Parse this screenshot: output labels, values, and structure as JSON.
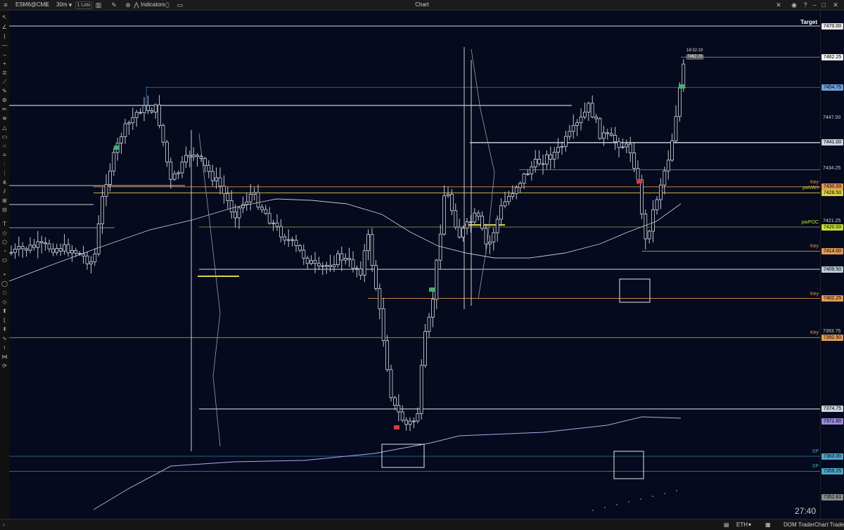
{
  "titlebar": {
    "symbol": "ESM6@CME",
    "timeframe": "30m",
    "lots": "1 Lots",
    "indicators": "Indicators",
    "window_title": "Chart"
  },
  "levels": [
    {
      "label": "",
      "price": "7470.00",
      "tag_color": "#e8e8e8"
    },
    {
      "label": "",
      "price": "7462.25",
      "tag_color": "#f2f2f2"
    },
    {
      "label": "",
      "price": "7454.75",
      "tag_color": "#6fa0d8"
    },
    {
      "label": "",
      "price": "7447.00",
      "tag_color": ""
    },
    {
      "label": "",
      "price": "7441.00",
      "tag_color": "#c9d4dc"
    },
    {
      "label": "",
      "price": "7434.25",
      "tag_color": ""
    },
    {
      "label": "Key",
      "price": "7430.00",
      "tag_color": "#e39a55"
    },
    {
      "label": "pwVAH",
      "price": "7428.50",
      "tag_color": "#d9cf3f"
    },
    {
      "label": "",
      "price": "7421.25",
      "tag_color": ""
    },
    {
      "label": "pwPOC",
      "price": "7420.00",
      "tag_color": "#c7dd3a"
    },
    {
      "label": "Key",
      "price": "7414.00",
      "tag_color": "#e39a55"
    },
    {
      "label": "",
      "price": "7409.50",
      "tag_color": "#b8c8d4"
    },
    {
      "label": "Key",
      "price": "7402.25",
      "tag_color": "#e39a55"
    },
    {
      "label": "",
      "price": "7393.75",
      "tag_color": ""
    },
    {
      "label": "Key",
      "price": "7392.50",
      "tag_color": "#e39a55"
    },
    {
      "label": "",
      "price": "7374.75",
      "tag_color": "#cdd6dc"
    },
    {
      "label": "",
      "price": "7371.60",
      "tag_color": "#9a88d8"
    },
    {
      "label": "SP",
      "price": "7363.00",
      "tag_color": "#4fa7c9"
    },
    {
      "label": "SP",
      "price": "7359.25",
      "tag_color": "#4fa7c9"
    },
    {
      "label": "",
      "price": "7352.81",
      "tag_color": "#8c8c8c"
    }
  ],
  "chart": {
    "target_label": "Target",
    "last_time": "18:32:19",
    "last_price": "7462.25",
    "countdown": "27:40",
    "up_color": "#05091c",
    "down_color": "#05091c",
    "wick_color": "#d6dbe2",
    "vwap_color": "#c6c6d2",
    "lower_ma_color": "#b7a6ea",
    "highlight_box_color": "#e6e6e6"
  },
  "bottombar": {
    "session": "ETH",
    "dom_trader": "DOM Trader",
    "chart_trader": "Chart Trader"
  }
}
